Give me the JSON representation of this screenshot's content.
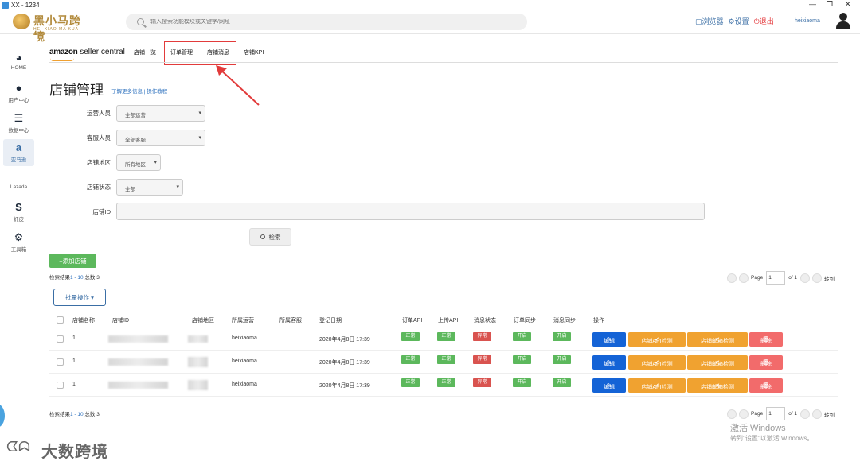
{
  "window": {
    "title": "XX - 1234"
  },
  "topbar": {
    "logo_text": "黑小马跨境",
    "logo_sub": "HEI XIAO MA KUA JING",
    "search_placeholder": "输入搜索功能模块或关键字/网址",
    "browser": "浏览器",
    "settings": "设置",
    "logout": "退出",
    "username": "heixiaoma"
  },
  "sidebar": {
    "items": [
      {
        "label": "HOME",
        "icon": "dashboard-icon"
      },
      {
        "label": "用户中心",
        "icon": "user-icon"
      },
      {
        "label": "数据中心",
        "icon": "database-icon"
      },
      {
        "label": "亚马逊",
        "icon": "amazon-icon"
      },
      {
        "label": "Lazada",
        "icon": "apple-icon"
      },
      {
        "label": "虾皮",
        "icon": "skype-icon"
      },
      {
        "label": "工具箱",
        "icon": "gears-icon"
      }
    ]
  },
  "header": {
    "brand_bold": "amazon",
    "brand_rest": " seller central",
    "tabs": [
      "店铺一览",
      "订单管理",
      "店铺消息",
      "店铺KPI"
    ]
  },
  "page": {
    "title": "店铺管理",
    "help_link": "了解更多信息 | 操作教程"
  },
  "filters": {
    "operator_label": "运营人员",
    "operator_value": "全部运营",
    "service_label": "客服人员",
    "service_value": "全部客服",
    "region_label": "店铺地区",
    "region_value": "所有地区",
    "status_label": "店铺状态",
    "status_value": "全部",
    "id_label": "店铺ID",
    "search_button": "检索"
  },
  "actions": {
    "add_store": "+添加店铺",
    "batch": "批量操作"
  },
  "results": {
    "prefix": "检索结果",
    "range": "1 - 10",
    "total": " 总数 3"
  },
  "pager": {
    "page_label": "Page",
    "page_value": "1",
    "of": "of 1",
    "goto": "转到"
  },
  "table": {
    "headers": [
      "店铺名称",
      "店铺ID",
      "店铺地区",
      "所属运营",
      "所属客服",
      "登记日期",
      "订单API",
      "上传API",
      "消息状态",
      "订单同步",
      "消息同步",
      "操作"
    ],
    "rows": [
      {
        "name": "1",
        "operator": "heixiaoma",
        "date": "2020年4月8日 17:39",
        "order_api": "正常",
        "upload_api": "正常",
        "msg_status": "异常",
        "order_sync": "开启",
        "msg_sync": "开启"
      },
      {
        "name": "1",
        "operator": "heixiaoma",
        "date": "2020年4月8日 17:39",
        "order_api": "正常",
        "upload_api": "正常",
        "msg_status": "异常",
        "order_sync": "开启",
        "msg_sync": "开启"
      },
      {
        "name": "1",
        "operator": "heixiaoma",
        "date": "2020年4月8日 17:39",
        "order_api": "正常",
        "upload_api": "正常",
        "msg_status": "异常",
        "order_sync": "开启",
        "msg_sync": "开启"
      }
    ],
    "btn_edit": "编辑",
    "btn_api": "店铺API检测",
    "btn_mail": "店铺邮箱检测",
    "btn_delete": "删除"
  },
  "overlay": {
    "watermark": "大数跨境",
    "activate_title": "激活 Windows",
    "activate_sub": "转到\"设置\"以激活 Windows。"
  },
  "colors": {
    "accent": "#1463d6",
    "success": "#5cb85c",
    "danger": "#d9534f",
    "warning": "#f0a230",
    "highlight_box": "#e23b3b"
  }
}
